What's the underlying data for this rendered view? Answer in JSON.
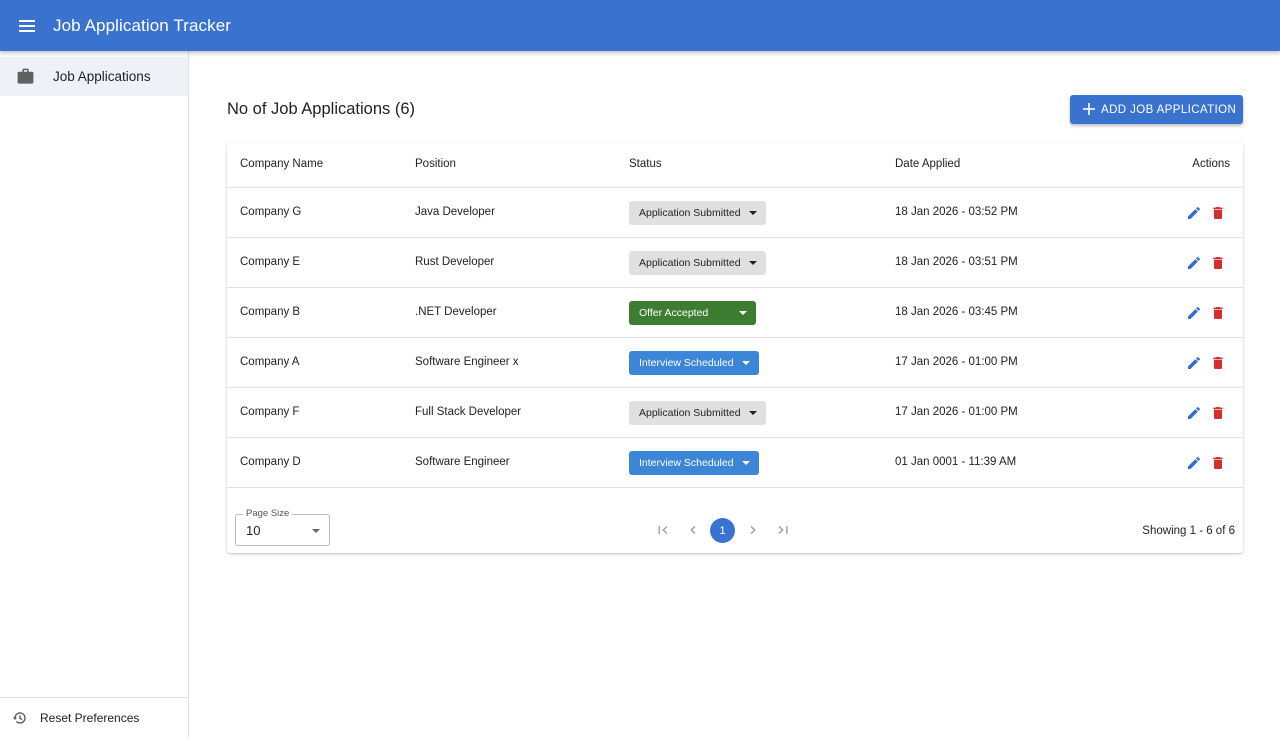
{
  "app": {
    "title": "Job Application Tracker"
  },
  "sidebar": {
    "items": [
      {
        "label": "Job Applications",
        "icon": "briefcase-icon"
      }
    ],
    "footer": {
      "label": "Reset Preferences",
      "icon": "history-icon"
    }
  },
  "main": {
    "heading": "No of Job Applications (6)",
    "add_button": "ADD JOB APPLICATION"
  },
  "table": {
    "columns": [
      "Company Name",
      "Position",
      "Status",
      "Date Applied",
      "Actions"
    ],
    "rows": [
      {
        "company": "Company G",
        "position": "Java Developer",
        "status": "Application Submitted",
        "date": "18 Jan 2026 - 03:52 PM"
      },
      {
        "company": "Company E",
        "position": "Rust Developer",
        "status": "Application Submitted",
        "date": "18 Jan 2026 - 03:51 PM"
      },
      {
        "company": "Company B",
        "position": ".NET Developer",
        "status": "Offer Accepted",
        "date": "18 Jan 2026 - 03:45 PM"
      },
      {
        "company": "Company A",
        "position": "Software Engineer x",
        "status": "Interview Scheduled",
        "date": "17 Jan 2026 - 01:00 PM"
      },
      {
        "company": "Company F",
        "position": "Full Stack Developer",
        "status": "Application Submitted",
        "date": "17 Jan 2026 - 01:00 PM"
      },
      {
        "company": "Company D",
        "position": "Software Engineer",
        "status": "Interview Scheduled",
        "date": "01 Jan 0001 - 11:39 AM"
      }
    ]
  },
  "status_colors": {
    "Application Submitted": {
      "bg": "#e0e0e0",
      "fg": "#222222"
    },
    "Offer Accepted": {
      "bg": "#3d7d32",
      "fg": "#ffffff"
    },
    "Interview Scheduled": {
      "bg": "#3b86d6",
      "fg": "#ffffff"
    }
  },
  "colors": {
    "primary": "#3a73cf",
    "edit": "#2f6fd1",
    "delete": "#d32f2f"
  },
  "pagination": {
    "page_size_label": "Page Size",
    "page_size": "10",
    "current_page": "1",
    "showing": "Showing 1 - 6 of 6"
  }
}
